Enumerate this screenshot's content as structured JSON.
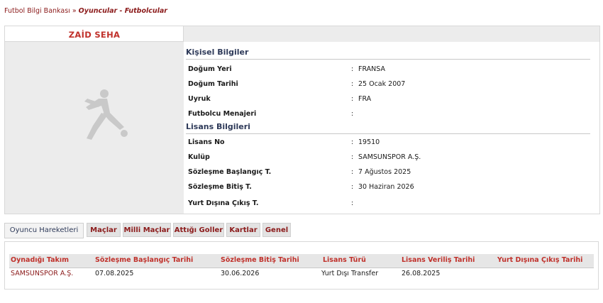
{
  "breadcrumb": {
    "root": "Futbol Bilgi Bankası",
    "sep": "»",
    "current": "Oyuncular - Futbolcular"
  },
  "player": {
    "name": "ZAİD SEHA"
  },
  "personal": {
    "heading": "Kişisel Bilgiler",
    "rows": [
      {
        "label": "Doğum Yeri",
        "colon": ":",
        "value": "FRANSA"
      },
      {
        "label": "Doğum Tarihi",
        "colon": ":",
        "value": "25 Ocak 2007"
      },
      {
        "label": "Uyruk",
        "colon": ":",
        "value": "FRA"
      },
      {
        "label": "Futbolcu Menajeri",
        "colon": ":",
        "value": ""
      }
    ]
  },
  "license": {
    "heading": "Lisans Bilgileri",
    "rows": [
      {
        "label": "Lisans No",
        "colon": ":",
        "value": "19510"
      },
      {
        "label": "Kulüp",
        "colon": ":",
        "value": "SAMSUNSPOR A.Ş."
      },
      {
        "label": "Sözleşme Başlangıç T.",
        "colon": ":",
        "value": "7 Ağustos 2025"
      },
      {
        "label": "Sözleşme Bitiş T.",
        "colon": ":",
        "value": "30 Haziran 2026"
      },
      {
        "label": "Yurt Dışına Çıkış T.",
        "colon": ":",
        "value": ""
      }
    ]
  },
  "tabs": [
    {
      "label": "Oyuncu Hareketleri",
      "active": true
    },
    {
      "label": "Maçlar",
      "active": false
    },
    {
      "label": "Milli Maçlar",
      "active": false
    },
    {
      "label": "Attığı Goller",
      "active": false
    },
    {
      "label": "Kartlar",
      "active": false
    },
    {
      "label": "Genel",
      "active": false
    }
  ],
  "movements": {
    "columns": [
      "Oynadığı Takım",
      "Sözleşme Başlangıç Tarihi",
      "Sözleşme Bitiş Tarihi",
      "Lisans Türü",
      "Lisans Veriliş Tarihi",
      "Yurt Dışına Çıkış Tarihi"
    ],
    "rows": [
      [
        "SAMSUNSPOR A.Ş.",
        "07.08.2025",
        "30.06.2026",
        "Yurt Dışı Transfer",
        "26.08.2025",
        ""
      ]
    ]
  },
  "colors": {
    "accent": "#8b1a1a",
    "name_red": "#c0312b",
    "heading_navy": "#2e3a59"
  }
}
